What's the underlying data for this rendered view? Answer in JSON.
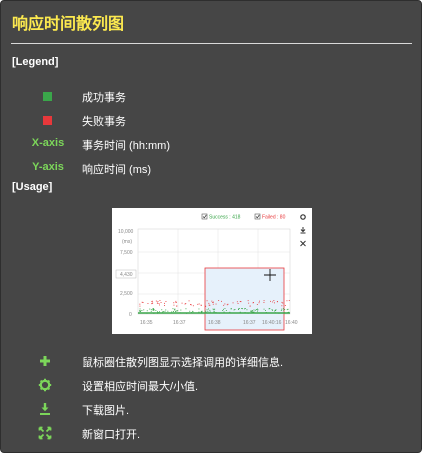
{
  "title": "响应时间散列图",
  "legend_header": "[Legend]",
  "legend": [
    {
      "key": "",
      "color": "#3aa64a",
      "text": "成功事务"
    },
    {
      "key": "",
      "color": "#e8383b",
      "text": "失败事务"
    },
    {
      "key": "X-axis",
      "text": "事务时间 (hh:mm)"
    },
    {
      "key": "Y-axis",
      "text": "响应时间 (ms)"
    }
  ],
  "usage_header": "[Usage]",
  "thumbnail": {
    "success_label": "Success : 418",
    "failed_label": "Failed : 80",
    "y_unit": "(ms)",
    "y_ticks": [
      "10,000",
      "7,500",
      "4,430",
      "2,500",
      "0"
    ],
    "x_ticks": [
      "16:35",
      "16:37",
      "16:38",
      "16:37",
      "16:40:16",
      "16:40"
    ],
    "colors": {
      "success": "#3aa64a",
      "failed": "#e8383b",
      "selection_fill": "#e6f1fb"
    }
  },
  "usage": [
    {
      "icon": "plus-icon",
      "text": "鼠标圈住散列图显示选择调用的详细信息."
    },
    {
      "icon": "gear-icon",
      "text": "设置相应时间最大/小值."
    },
    {
      "icon": "download-icon",
      "text": "下载图片."
    },
    {
      "icon": "expand-icon",
      "text": "新窗口打开."
    }
  ],
  "accent_color": "#7cd65a"
}
